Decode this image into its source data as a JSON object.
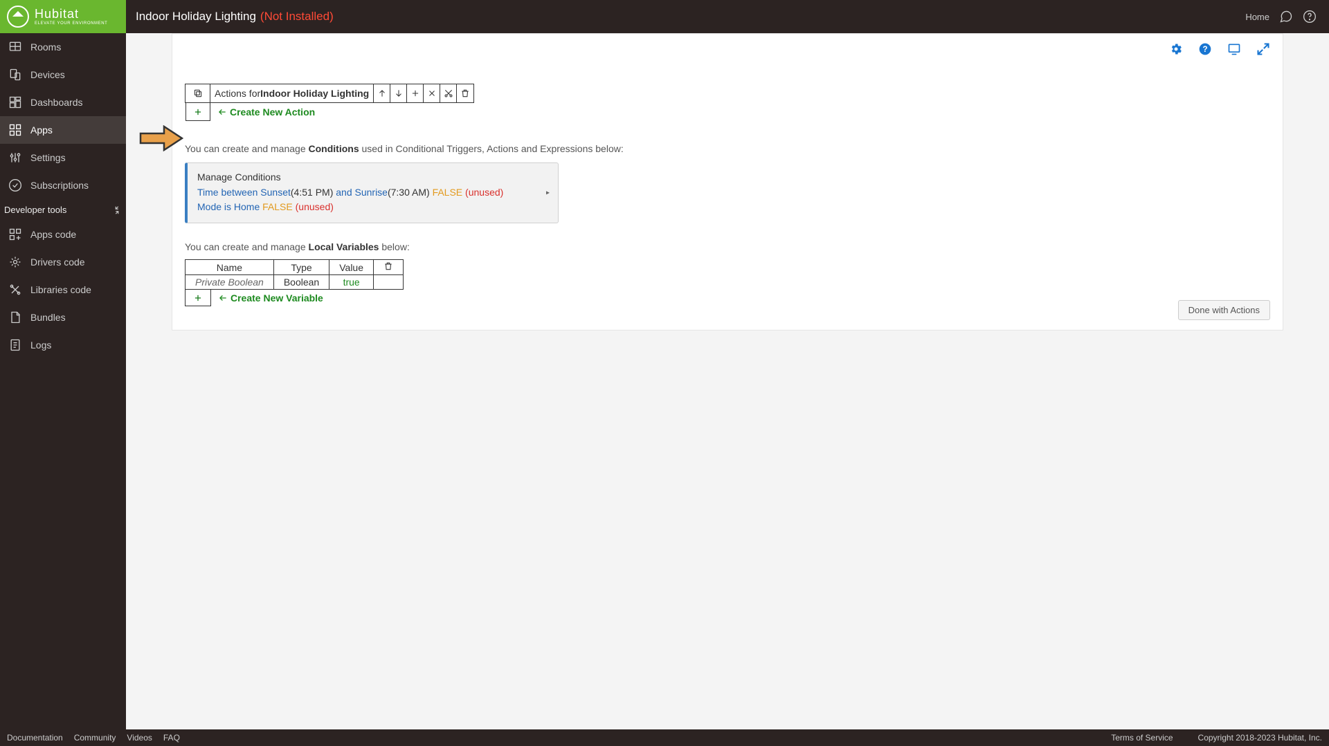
{
  "header": {
    "brand": "Hubitat",
    "tagline": "ELEVATE YOUR ENVIRONMENT",
    "page_title": "Indoor Holiday Lighting",
    "status": "(Not Installed)",
    "home_link": "Home"
  },
  "sidebar": {
    "items": [
      {
        "label": "Rooms",
        "icon": "rooms"
      },
      {
        "label": "Devices",
        "icon": "devices"
      },
      {
        "label": "Dashboards",
        "icon": "dash"
      },
      {
        "label": "Apps",
        "icon": "apps",
        "active": true
      },
      {
        "label": "Settings",
        "icon": "settings"
      },
      {
        "label": "Subscriptions",
        "icon": "subs"
      }
    ],
    "dev_header": "Developer tools",
    "dev_items": [
      {
        "label": "Apps code",
        "icon": "appscode"
      },
      {
        "label": "Drivers code",
        "icon": "drivers"
      },
      {
        "label": "Libraries code",
        "icon": "libs"
      },
      {
        "label": "Bundles",
        "icon": "bundles"
      },
      {
        "label": "Logs",
        "icon": "logs"
      }
    ]
  },
  "toolbar": {
    "prefix": "Actions for ",
    "title_bold": "Indoor Holiday Lighting",
    "create_action": "Create New Action"
  },
  "conditions": {
    "intro_pre": "You can create and manage ",
    "intro_bold": "Conditions",
    "intro_post": " used in Conditional Triggers, Actions and Expressions below:",
    "box_title": "Manage Conditions",
    "line1_a": "Time between Sunset",
    "line1_b": "(4:51 PM) ",
    "line1_c": "and Sunrise",
    "line1_d": "(7:30 AM) ",
    "line1_false": "FALSE",
    "line1_unused": " (unused)",
    "line2_a": "Mode is Home ",
    "line2_false": "FALSE",
    "line2_unused": " (unused)"
  },
  "variables": {
    "intro_pre": "You can create and manage ",
    "intro_bold": "Local Variables",
    "intro_post": " below:",
    "headers": {
      "name": "Name",
      "type": "Type",
      "value": "Value"
    },
    "rows": [
      {
        "name": "Private Boolean",
        "type": "Boolean",
        "value": "true"
      }
    ],
    "create_variable": "Create New Variable"
  },
  "buttons": {
    "done": "Done with Actions"
  },
  "footer": {
    "left": [
      "Documentation",
      "Community",
      "Videos",
      "FAQ"
    ],
    "right": [
      "Terms of Service",
      "Copyright 2018-2023 Hubitat, Inc."
    ]
  }
}
